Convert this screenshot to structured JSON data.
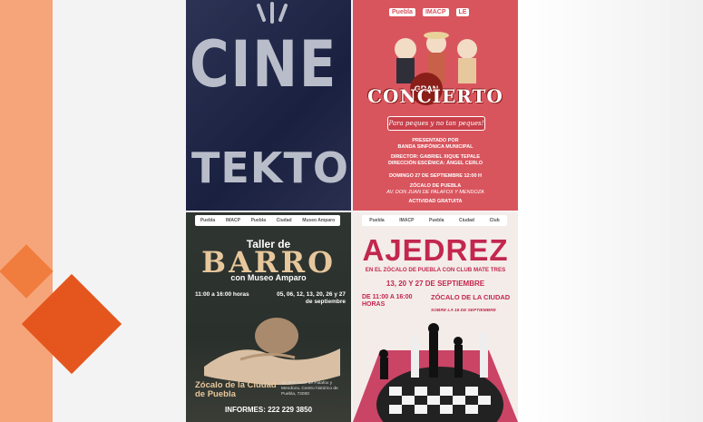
{
  "posters": {
    "cine": {
      "line1": "CINE",
      "line2": "TEKTON"
    },
    "concierto": {
      "logos": [
        "Puebla",
        "IMACP",
        "LE"
      ],
      "badge": "GRAN",
      "title": "CONCIERTO",
      "tagline": "Para peques y no tan peques!",
      "presented_label": "PRESENTADO POR",
      "presenter": "BANDA SINFÓNICA MUNICIPAL",
      "director": "DIRECTOR: GABRIEL XIQUE TEPALE",
      "scenic": "DIRECCIÓN ESCÉNICA: ÁNGEL CERLO",
      "date": "DOMINGO 27 DE SEPTIEMBRE 12:00 H",
      "venue": "ZÓCALO DE PUEBLA",
      "venue_address": "AV. DON JUAN DE PALAFOX Y MENDOZA",
      "free": "ACTIVIDAD GRATUITA"
    },
    "barro": {
      "logos": [
        "Puebla",
        "IMACP",
        "Puebla",
        "Ciudad",
        "Museo Amparo"
      ],
      "taller": "Taller de",
      "title": "BARRO",
      "subtitle": "con Museo Amparo",
      "hours": "11:00 a 16:00 horas",
      "dates": "05, 06, 12, 13, 20, 26 y 27 de septiembre",
      "venue": "Zócalo de la Ciudad de Puebla",
      "address": "Av. Don Juan de Palafox y Mendoza, Centro histórico de Puebla, 72000",
      "informes": "INFORMES: 222 229 3850"
    },
    "ajedrez": {
      "logos": [
        "Puebla",
        "IMACP",
        "Puebla",
        "Ciudad",
        "Club"
      ],
      "title": "AJEDREZ",
      "club": "EN EL ZÓCALO DE PUEBLA CON CLUB MATE TRES",
      "dates": "13, 20 Y 27 DE SEPTIEMBRE",
      "hours": "DE 11:00 A 16:00 HORAS",
      "venue": "ZÓCALO DE LA CIUDAD",
      "venue_sub": "SOBRE LA 16 DE SEPTIEMBRE"
    }
  },
  "colors": {
    "accent_orange": "#e4561e",
    "concierto_bg": "#d9555e",
    "ajedrez_red": "#c2274e",
    "barro_gold": "#e7c79c"
  }
}
